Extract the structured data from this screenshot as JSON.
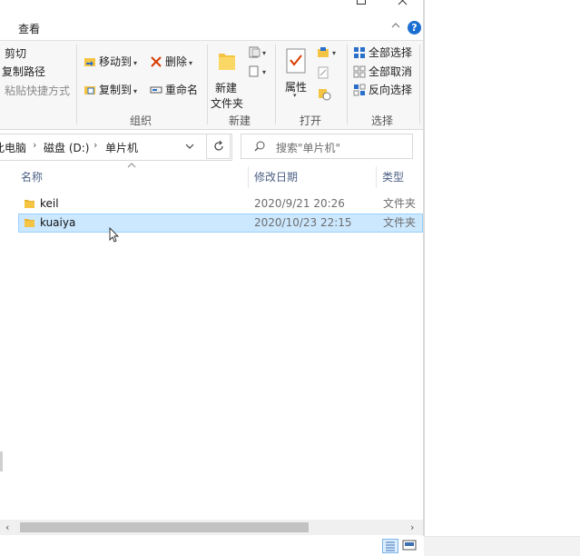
{
  "window": {
    "tab_view": "查看"
  },
  "ribbon": {
    "clipboard": {
      "cut": "剪切",
      "copy_path": "复制路径",
      "paste_shortcut": "粘贴快捷方式"
    },
    "organize": {
      "move_to": "移动到",
      "copy_to": "复制到",
      "delete": "删除",
      "rename": "重命名",
      "group_label": "组织"
    },
    "new": {
      "new_folder_line1": "新建",
      "new_folder_line2": "文件夹",
      "group_label": "新建"
    },
    "open": {
      "properties": "属性",
      "group_label": "打开"
    },
    "select": {
      "select_all": "全部选择",
      "select_none": "全部取消",
      "invert": "反向选择",
      "group_label": "选择"
    }
  },
  "address": {
    "crumbs": [
      "此电脑",
      "磁盘 (D:)",
      "单片机"
    ],
    "search_placeholder": "搜索\"单片机\""
  },
  "columns": {
    "name": "名称",
    "date": "修改日期",
    "type": "类型"
  },
  "files": [
    {
      "name": "keil",
      "date": "2020/9/21 20:26",
      "type": "文件夹",
      "selected": false
    },
    {
      "name": "kuaiya",
      "date": "2020/10/23 22:15",
      "type": "文件夹",
      "selected": true
    }
  ],
  "colors": {
    "selection_bg": "#cce8ff",
    "selection_border": "#99d1ff",
    "accent": "#1a6fd0",
    "folder": "#f5c443"
  }
}
